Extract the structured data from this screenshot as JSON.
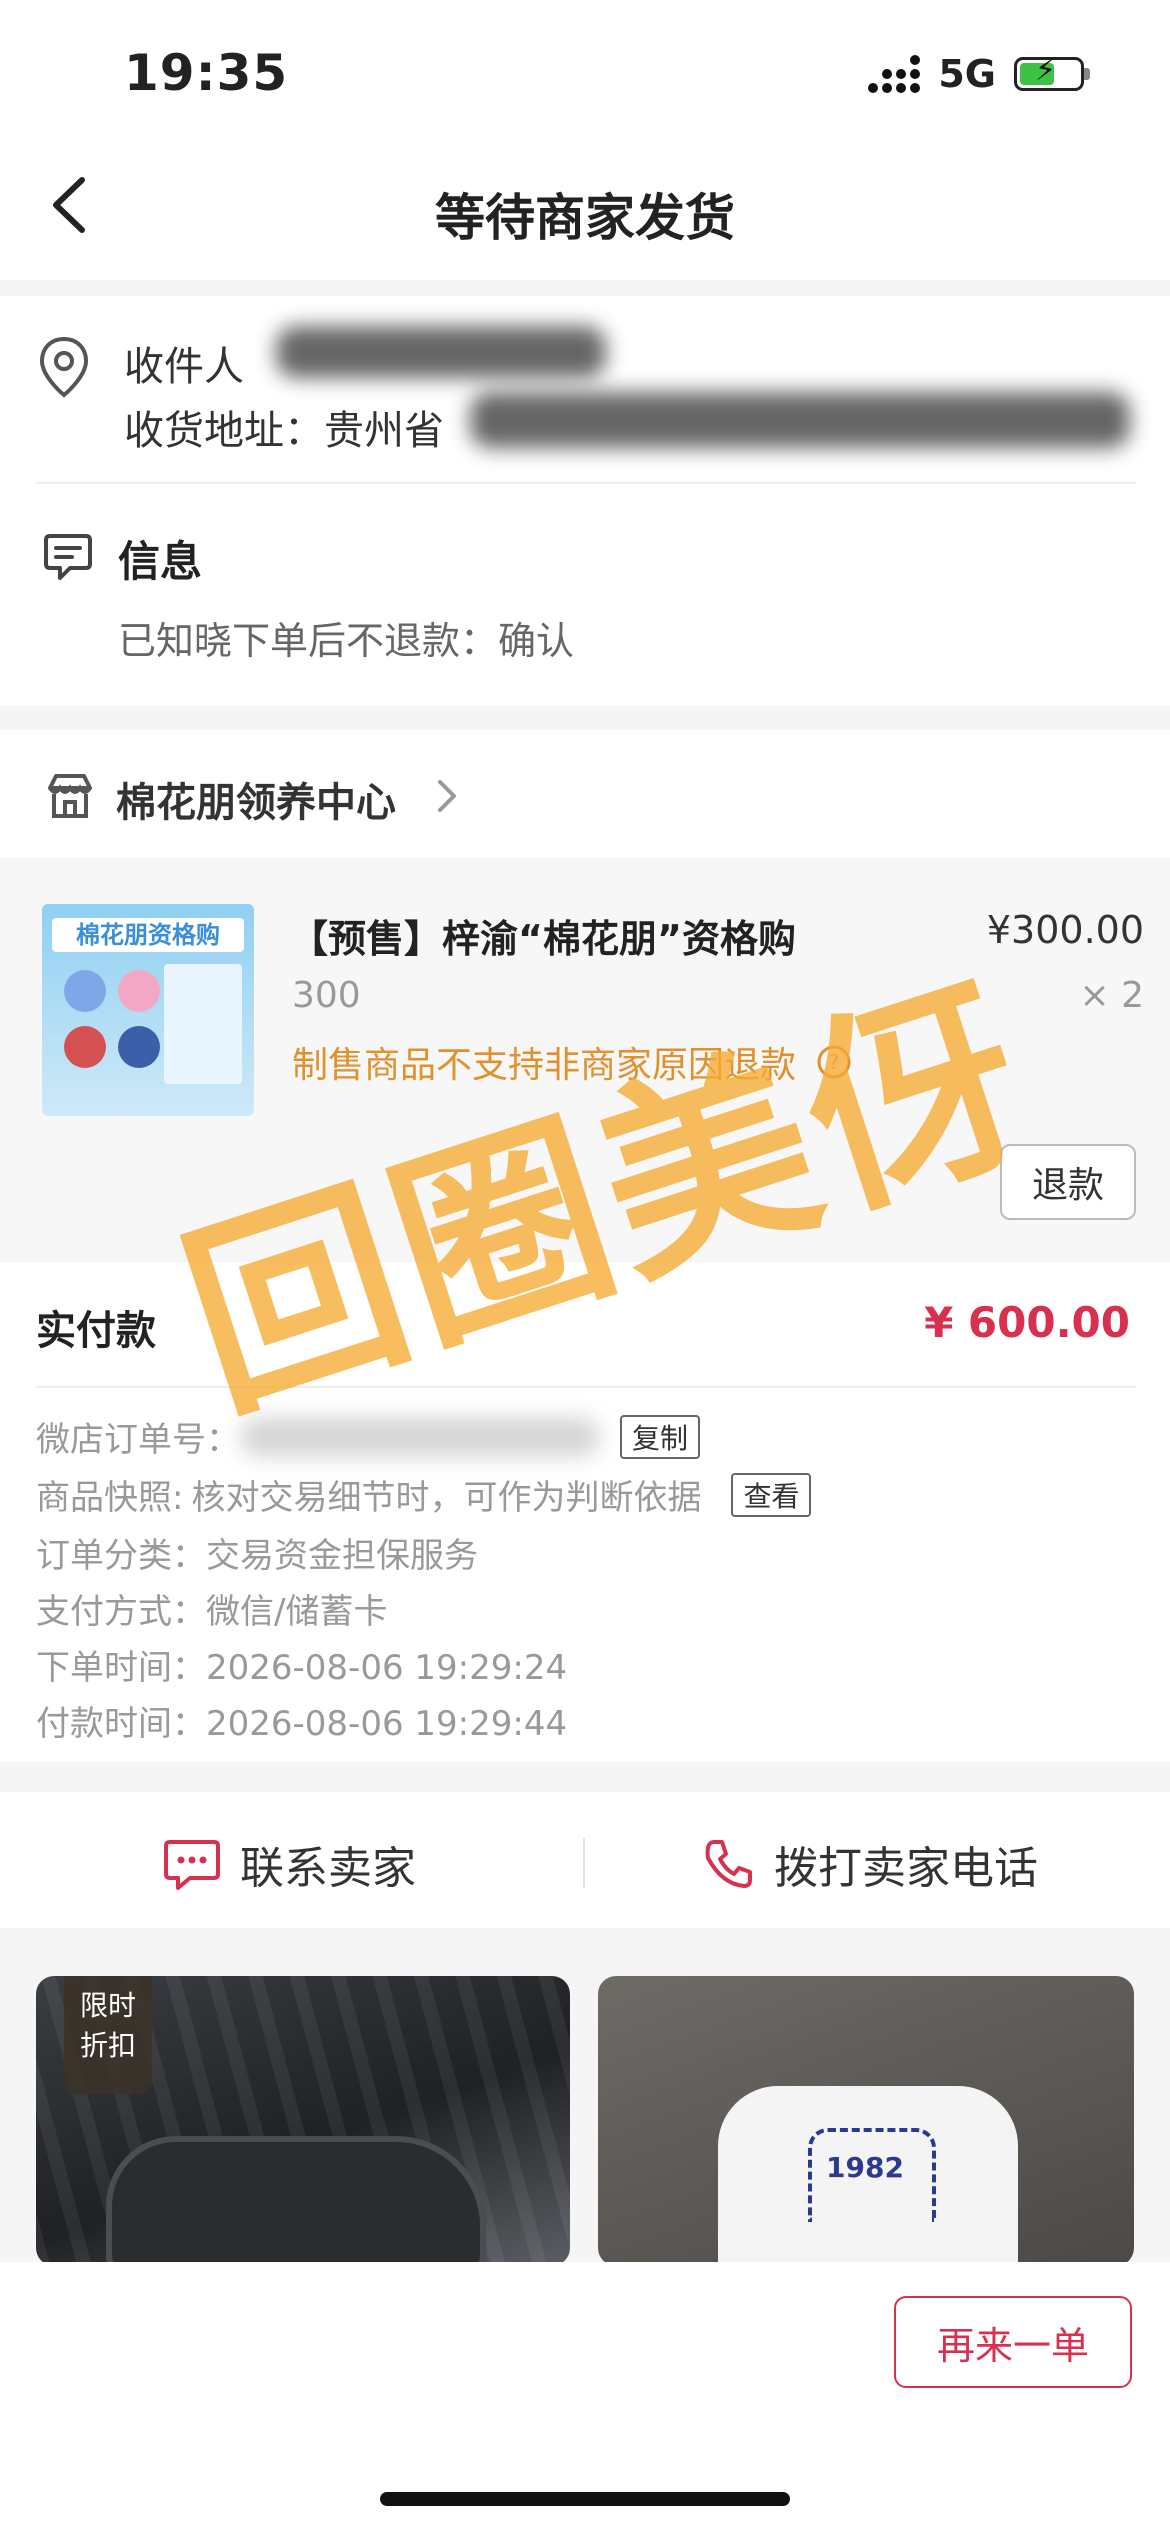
{
  "status_bar": {
    "time": "19:35",
    "network": "5G"
  },
  "nav": {
    "title": "等待商家发货"
  },
  "address": {
    "recipient_label": "收件人",
    "address_label": "收货地址：贵州省"
  },
  "info": {
    "title": "信息",
    "text": "已知晓下单后不退款：确认"
  },
  "shop": {
    "name": "棉花朋领养中心"
  },
  "product": {
    "thumb_text": "棉花朋资格购",
    "title": "【预售】梓渝“棉花朋”资格购",
    "variant": "300",
    "price": "¥300.00",
    "quantity": "× 2",
    "notice": "制售商品不支持非商家原因退款",
    "refund_button": "退款"
  },
  "watermark": "回圈美伢",
  "payment": {
    "label": "实付款",
    "amount": "¥ 600.00"
  },
  "order": {
    "order_no_label": "微店订单号：",
    "copy_button": "复制",
    "snapshot_label": "商品快照:",
    "snapshot_text": "核对交易细节时，可作为判断依据",
    "view_button": "查看",
    "category_label": "订单分类：",
    "category_value": "交易资金担保服务",
    "pay_method_label": "支付方式：",
    "pay_method_value": "微信/储蓄卡",
    "order_time_label": "下单时间：",
    "order_time_value": "2026-08-06 19:29:24",
    "pay_time_label": "付款时间：",
    "pay_time_value": "2026-08-06 19:29:44"
  },
  "contact": {
    "chat_label": "联系卖家",
    "call_label": "拨打卖家电话"
  },
  "recommend": {
    "badge_line1": "限时",
    "badge_line2": "折扣",
    "jacket_text": "1982"
  },
  "bottom": {
    "reorder_button": "再来一单"
  },
  "colors": {
    "accent": "#d8304f",
    "warning": "#e0912c",
    "watermark": "#f6aa32"
  }
}
